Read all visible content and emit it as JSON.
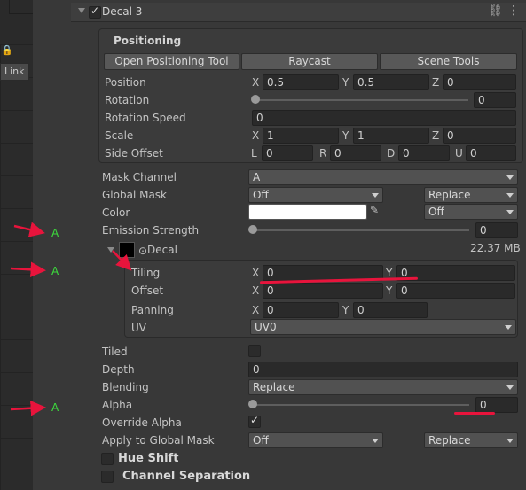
{
  "left_panel": {
    "link_label": "Link"
  },
  "header": {
    "title": "Decal 3",
    "enabled": true
  },
  "positioning": {
    "title": "Positioning",
    "buttons": [
      "Open Positioning Tool",
      "Raycast",
      "Scene Tools"
    ],
    "position": {
      "label": "Position",
      "x": "0.5",
      "y": "0.5",
      "z": "0"
    },
    "rotation": {
      "label": "Rotation",
      "value": "0",
      "slider_fraction": 0
    },
    "rotation_speed": {
      "label": "Rotation Speed",
      "value": "0"
    },
    "scale": {
      "label": "Scale",
      "x": "1",
      "y": "1",
      "z": "0"
    },
    "side_offset": {
      "label": "Side Offset",
      "l": "0",
      "r": "0",
      "d": "0",
      "u": "0"
    }
  },
  "axes": {
    "x": "X",
    "y": "Y",
    "z": "Z",
    "l": "L",
    "r": "R",
    "d": "D",
    "u": "U"
  },
  "mask_channel": {
    "label": "Mask Channel",
    "value": "A"
  },
  "global_mask": {
    "label": "Global Mask",
    "value": "Off",
    "mode": "Replace"
  },
  "color": {
    "label": "Color",
    "value": "#ffffff",
    "mode": "Off"
  },
  "emission": {
    "label": "Emission Strength",
    "value": "0",
    "slider_fraction": 0
  },
  "decal": {
    "label": "Decal",
    "size": "22.37 MB",
    "tiling": {
      "label": "Tiling",
      "x": "0",
      "y": "0"
    },
    "offset": {
      "label": "Offset",
      "x": "0",
      "y": "0"
    },
    "panning": {
      "label": "Panning",
      "x": "0",
      "y": "0"
    },
    "uv": {
      "label": "UV",
      "value": "UV0"
    }
  },
  "tiled": {
    "label": "Tiled",
    "checked": false
  },
  "depth": {
    "label": "Depth",
    "value": "0"
  },
  "blending": {
    "label": "Blending",
    "value": "Replace"
  },
  "alpha": {
    "label": "Alpha",
    "value": "0",
    "slider_fraction": 0
  },
  "override_alpha": {
    "label": "Override Alpha",
    "checked": true
  },
  "apply_global_mask": {
    "label": "Apply to Global Mask",
    "value": "Off",
    "mode": "Replace"
  },
  "hue_shift": {
    "label": "Hue Shift",
    "checked": false
  },
  "channel_separation": {
    "label": "Channel Separation",
    "checked": false
  },
  "annotations": {
    "marker": "A"
  },
  "colors": {
    "annotation_red": "#e8143c",
    "annotation_green": "#3ddc3d",
    "panel_bg": "#383838"
  }
}
